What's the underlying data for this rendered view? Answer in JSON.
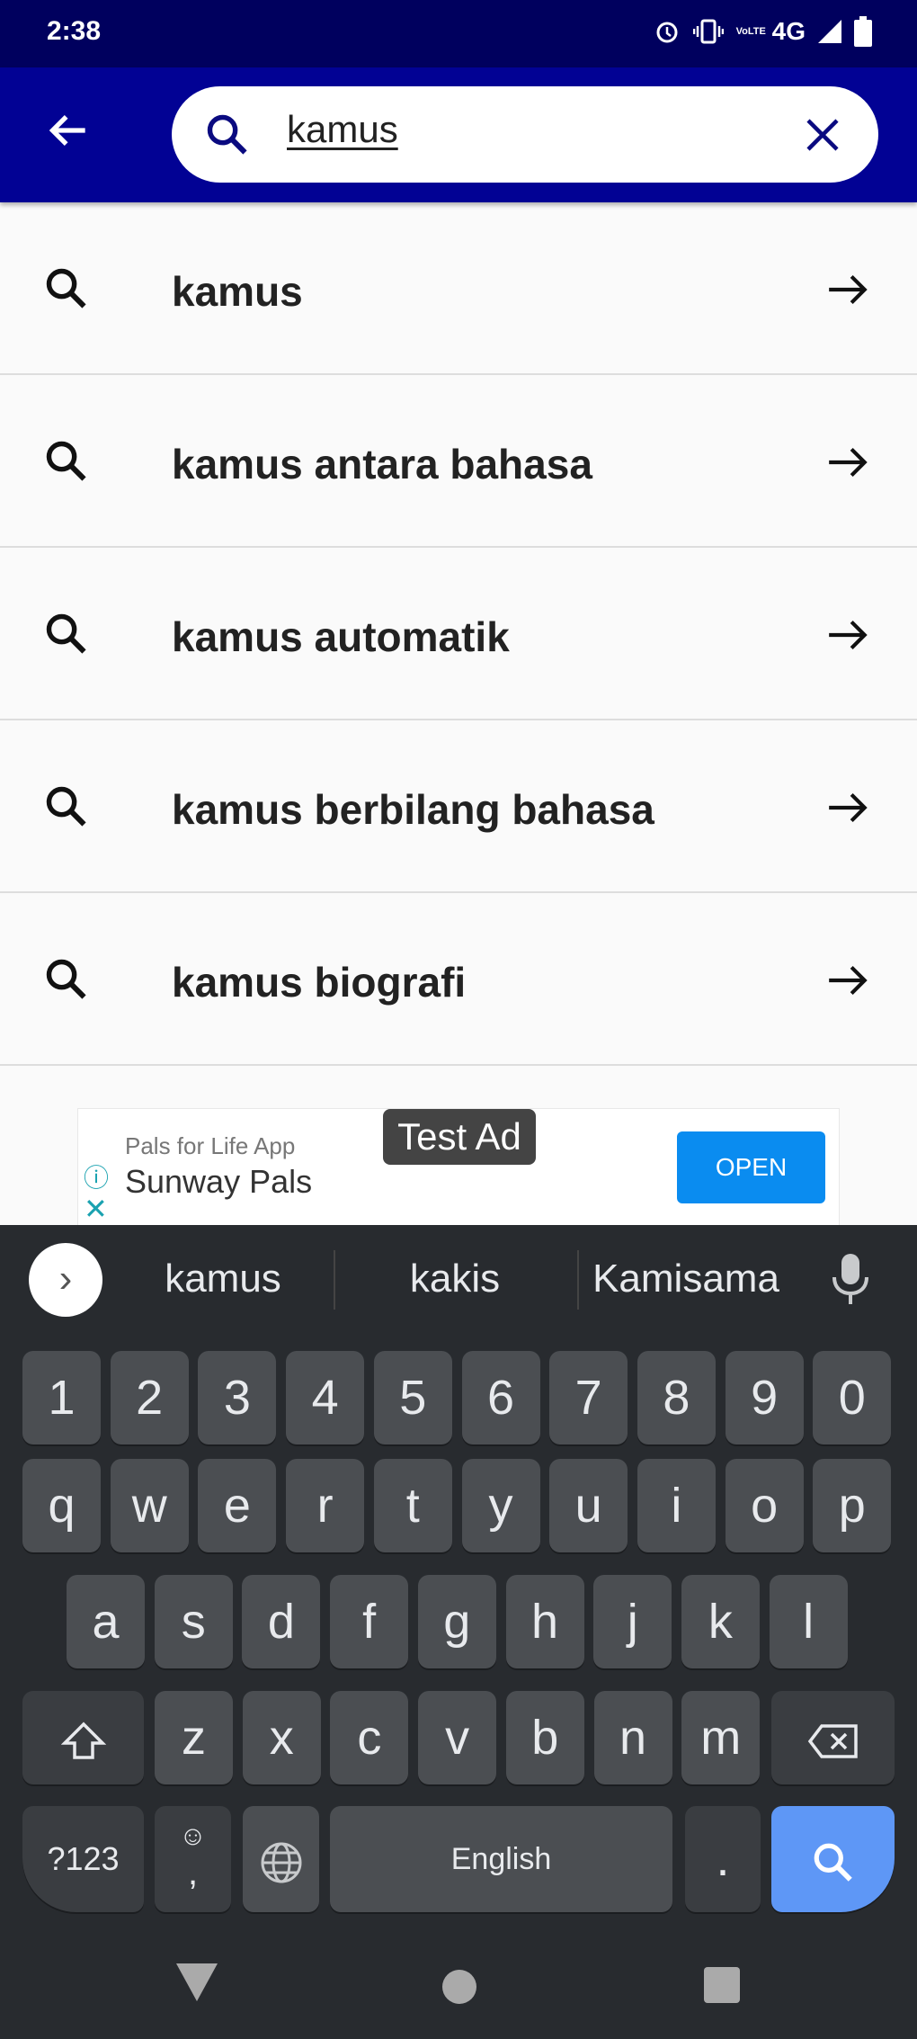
{
  "status_bar": {
    "time": "2:38",
    "network": "4G",
    "volte": "VoLTE",
    "icons": [
      "alarm-icon",
      "vibrate-icon",
      "volte-icon",
      "signal-icon",
      "battery-icon"
    ]
  },
  "search": {
    "query": "kamus",
    "back_icon": "arrow-left-icon",
    "search_icon": "search-icon",
    "clear_icon": "close-icon"
  },
  "suggestions": [
    {
      "text": "kamus"
    },
    {
      "text": "kamus antara bahasa"
    },
    {
      "text": "kamus automatik"
    },
    {
      "text": "kamus berbilang bahasa"
    },
    {
      "text": "kamus biografi"
    }
  ],
  "ad": {
    "badge": "Test Ad",
    "subtitle": "Pals for Life App",
    "title": "Sunway Pals",
    "cta": "OPEN",
    "info_icon": "ⓘ",
    "close_icon": "✕"
  },
  "keyboard": {
    "word_suggestions": [
      "kamus",
      "kakis",
      "Kamisama"
    ],
    "rows": [
      [
        "1",
        "2",
        "3",
        "4",
        "5",
        "6",
        "7",
        "8",
        "9",
        "0"
      ],
      [
        "q",
        "w",
        "e",
        "r",
        "t",
        "y",
        "u",
        "i",
        "o",
        "p"
      ],
      [
        "a",
        "s",
        "d",
        "f",
        "g",
        "h",
        "j",
        "k",
        "l"
      ],
      [
        "z",
        "x",
        "c",
        "v",
        "b",
        "n",
        "m"
      ]
    ],
    "symbols_label": "?123",
    "comma": ",",
    "emoji": "☺",
    "space_label": "English",
    "period": ".",
    "accent_color": "#5e97f6"
  },
  "colors": {
    "status_bar": "#00005e",
    "app_bar": "#020294",
    "search_icon": "#0a0a80"
  }
}
